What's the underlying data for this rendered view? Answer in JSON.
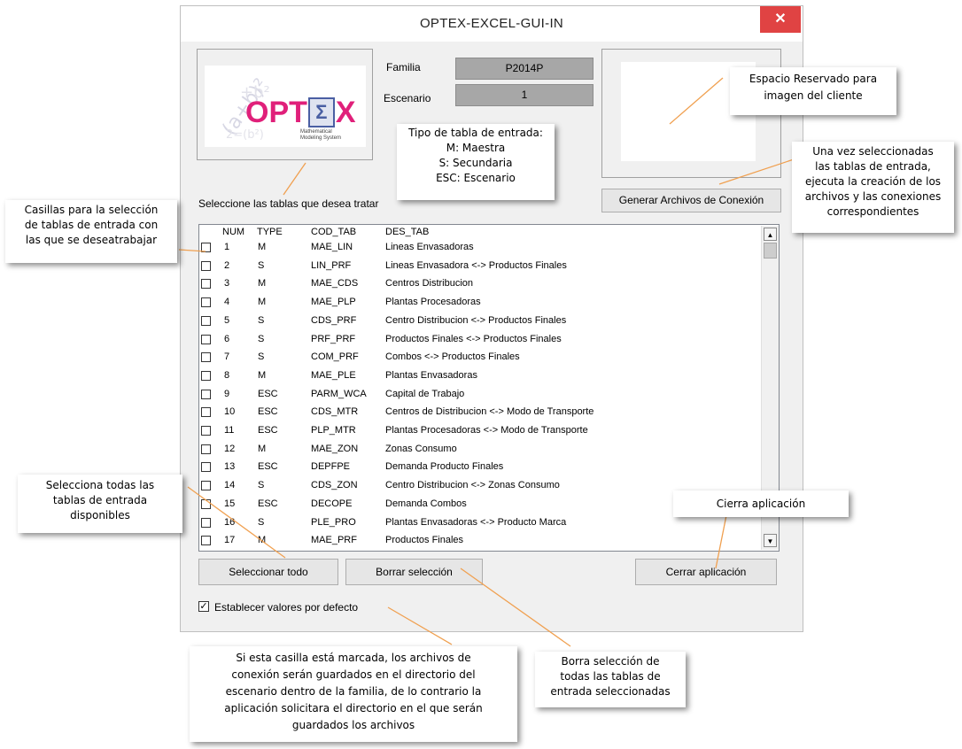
{
  "window": {
    "title": "OPTEX-EXCEL-GUI-IN",
    "close_glyph": "✕"
  },
  "logo": {
    "brand": "OPTΣX",
    "tagline_line1": "Mathematical",
    "tagline_line2": "Modeling System",
    "formula_text": "(a+b)²=a²+2ab+b²"
  },
  "form": {
    "familia_label": "Familia",
    "familia_value": "P2014P",
    "escenario_label": "Escenario",
    "escenario_value": "1"
  },
  "buttons": {
    "generar": "Generar Archivos de Conexión",
    "seleccionar_todo": "Seleccionar todo",
    "borrar": "Borrar selección",
    "cerrar": "Cerrar aplicación"
  },
  "list": {
    "prompt": "Seleccione las tablas que desea tratar",
    "headers": [
      "NUM",
      "TYPE",
      "COD_TAB",
      "DES_TAB"
    ],
    "rows": [
      {
        "num": "1",
        "type": "M",
        "cod": "MAE_LIN",
        "des": "Lineas Envasadoras"
      },
      {
        "num": "2",
        "type": "S",
        "cod": "LIN_PRF",
        "des": "Lineas Envasadora <-> Productos Finales"
      },
      {
        "num": "3",
        "type": "M",
        "cod": "MAE_CDS",
        "des": "Centros Distribucion"
      },
      {
        "num": "4",
        "type": "M",
        "cod": "MAE_PLP",
        "des": "Plantas Procesadoras"
      },
      {
        "num": "5",
        "type": "S",
        "cod": "CDS_PRF",
        "des": "Centro Distribucion <-> Productos Finales"
      },
      {
        "num": "6",
        "type": "S",
        "cod": "PRF_PRF",
        "des": "Productos Finales <-> Productos Finales"
      },
      {
        "num": "7",
        "type": "S",
        "cod": "COM_PRF",
        "des": "Combos <-> Productos Finales"
      },
      {
        "num": "8",
        "type": "M",
        "cod": "MAE_PLE",
        "des": "Plantas Envasadoras"
      },
      {
        "num": "9",
        "type": "ESC",
        "cod": "PARM_WCA",
        "des": "Capital de Trabajo"
      },
      {
        "num": "10",
        "type": "ESC",
        "cod": "CDS_MTR",
        "des": "Centros de Distribucion <-> Modo de Transporte"
      },
      {
        "num": "11",
        "type": "ESC",
        "cod": "PLP_MTR",
        "des": "Plantas Procesadoras <-> Modo de Transporte"
      },
      {
        "num": "12",
        "type": "M",
        "cod": "MAE_ZON",
        "des": "Zonas Consumo"
      },
      {
        "num": "13",
        "type": "ESC",
        "cod": "DEPFPE",
        "des": "Demanda Producto Finales"
      },
      {
        "num": "14",
        "type": "S",
        "cod": "CDS_ZON",
        "des": "Centro Distribucion <-> Zonas Consumo"
      },
      {
        "num": "15",
        "type": "ESC",
        "cod": "DECOPE",
        "des": "Demanda Combos"
      },
      {
        "num": "16",
        "type": "S",
        "cod": "PLE_PRO",
        "des": "Plantas Envasadoras <-> Producto Marca"
      },
      {
        "num": "17",
        "type": "M",
        "cod": "MAE_PRF",
        "des": "Productos Finales"
      }
    ]
  },
  "defaults_checkbox": {
    "label": "Establecer valores por defecto",
    "checked": true
  },
  "annotations": {
    "tipo": [
      "Tipo de tabla de entrada:",
      "M: Maestra",
      "S: Secundaria",
      "ESC: Escenario"
    ],
    "espacio": [
      "Espacio Reservado para",
      "imagen del cliente"
    ],
    "una_vez": [
      "Una vez seleccionadas",
      "las tablas de entrada,",
      "ejecuta la creación de los",
      "archivos y las conexiones",
      "correspondientes"
    ],
    "casillas": [
      "Casillas para la selección",
      "de tablas de entrada con",
      "las que se deseatrabajar"
    ],
    "selecciona": [
      "Selecciona todas las",
      "tablas de entrada",
      "disponibles"
    ],
    "cierra": [
      "Cierra aplicación"
    ],
    "borra": [
      "Borra selección de",
      "todas las tablas de",
      "entrada seleccionadas"
    ],
    "si_esta": [
      "Si esta casilla está marcada,  los archivos de",
      "conexión serán guardados en el directorio del",
      "escenario dentro de la familia, de lo contrario la",
      "aplicación solicitara el directorio en el que serán",
      "guardados los archivos"
    ]
  },
  "colors": {
    "close": "#e04343",
    "leader_line": "#f0a050",
    "field": "#a7a7a7"
  }
}
